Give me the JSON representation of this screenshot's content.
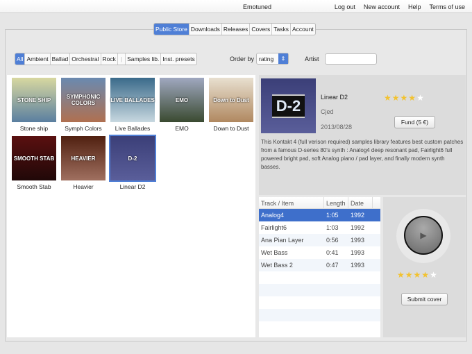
{
  "app": {
    "title": "Emotuned",
    "links": [
      "Log out",
      "New account",
      "Help",
      "Terms of use"
    ]
  },
  "tabs": [
    {
      "label": "Public Store",
      "active": true
    },
    {
      "label": "Downloads"
    },
    {
      "label": "Releases"
    },
    {
      "label": "Covers"
    },
    {
      "label": "Tasks"
    },
    {
      "label": "Account"
    }
  ],
  "filters": {
    "genres": [
      "All",
      "Ambient",
      "Ballad",
      "Orchestral",
      "Rock"
    ],
    "types": [
      "Samples lib.",
      "Inst. presets"
    ],
    "active": "All",
    "order_label": "Order by",
    "order_value": "rating",
    "artist_label": "Artist",
    "artist_value": ""
  },
  "covers": [
    {
      "label": "Stone ship",
      "art": "STONE SHIP",
      "colors": [
        "#d8d8a0",
        "#5a7fa0"
      ]
    },
    {
      "label": "Symph Colors",
      "art": "SYMPHONIC COLORS",
      "colors": [
        "#6a8ab0",
        "#b07050"
      ]
    },
    {
      "label": "Live Ballades",
      "art": "LIVE BALLADES",
      "colors": [
        "#3a6a8a",
        "#c8d8e0"
      ]
    },
    {
      "label": "EMO",
      "art": "EMO",
      "colors": [
        "#a0a8c0",
        "#3a4a30"
      ]
    },
    {
      "label": "Down to Dust",
      "art": "Down to Dust",
      "colors": [
        "#e8e0d0",
        "#b08860"
      ]
    },
    {
      "label": "Smooth Stab",
      "art": "SMOOTH STAB",
      "colors": [
        "#5a1010",
        "#200808"
      ]
    },
    {
      "label": "Heavier",
      "art": "HEAVIER",
      "colors": [
        "#502010",
        "#a07060"
      ]
    },
    {
      "label": "Linear D2",
      "art": "D-2",
      "colors": [
        "#3b3f78",
        "#5a5e9a"
      ],
      "selected": true
    }
  ],
  "detail": {
    "title": "Linear D2",
    "artist": "Cjed",
    "date": "2013/08/28",
    "rating": 4,
    "max_rating": 5,
    "fund_label": "Fund (5 €)",
    "cover_art": "D-2",
    "description": "This Kontakt 4 (full verison required) samples library features best custom patches from a famous D-series 80's synth : Analog4 deep resonant pad, Fairlight6 full powered bright pad, soft Analog piano / pad layer, and finally modern synth basses."
  },
  "tracks": {
    "headers": [
      "Track / Item",
      "Length",
      "Date"
    ],
    "rows": [
      [
        "Analog4",
        "1:05",
        "1992"
      ],
      [
        "Fairlight6",
        "1:03",
        "1992"
      ],
      [
        "Ana Pian Layer",
        "0:56",
        "1993"
      ],
      [
        "Wet Bass",
        "0:41",
        "1993"
      ],
      [
        "Wet Bass 2",
        "0:47",
        "1993"
      ]
    ],
    "selected": 0
  },
  "player": {
    "rating": 4,
    "submit_label": "Submit cover"
  },
  "accent": "#4f7fd6"
}
